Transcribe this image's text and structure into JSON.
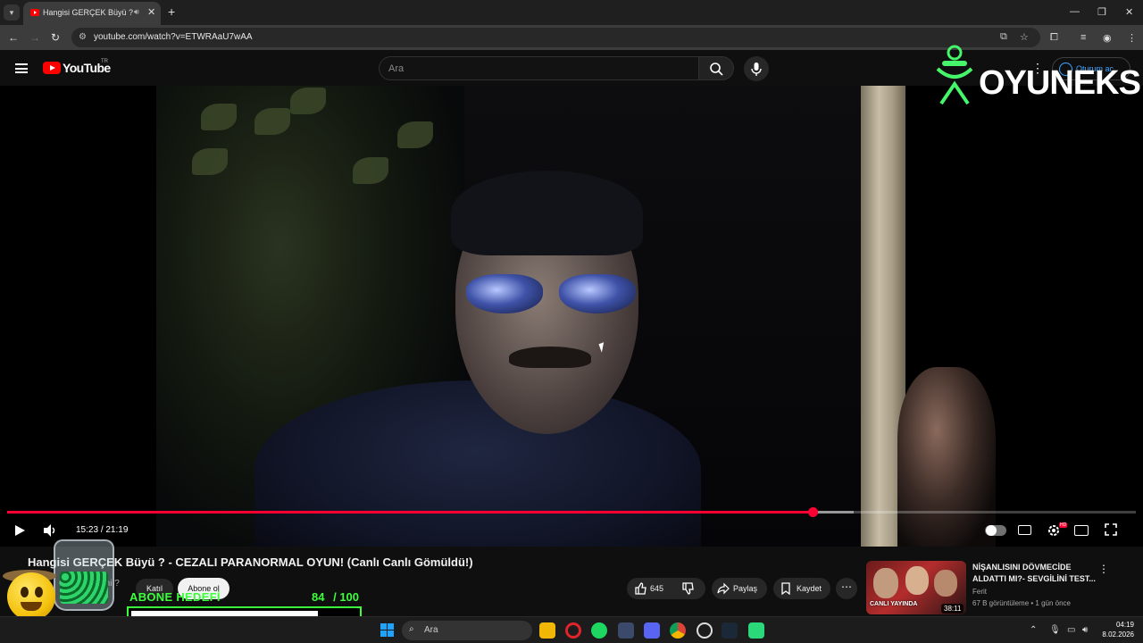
{
  "browser": {
    "tab_title": "Hangisi GERÇEK Büyü ? - C",
    "url": "youtube.com/watch?v=ETWRAaU7wAA"
  },
  "youtube": {
    "logo_text": "YouTube",
    "country": "TR",
    "search_placeholder": "Ara",
    "signin_label": "Oturum aç"
  },
  "player": {
    "time_current": "15:23",
    "time_total": "21:19",
    "played_fraction": 0.714,
    "buffered_fraction": 0.75,
    "hd_badge": "HD"
  },
  "video": {
    "title": "Hangisi GERÇEK Büyü ? - CEZALI PARANORMAL OYUN! (Canlı Canlı Gömüldü!)",
    "channel_sub": "Gerçekten mi ?",
    "join_label": "Katıl",
    "subscribe_label": "Abone ol",
    "like_count": "645",
    "share_label": "Paylaş",
    "save_label": "Kaydet"
  },
  "recommendation": {
    "title": "NİŞANLISINI DÖVMECİDE ALDATTI MI?- SEVGİLİNİ TEST...",
    "channel": "Ferit",
    "meta": "67 B görüntüleme • 1 gün önce",
    "duration": "38:11",
    "thumb_text": "CANLI YAYINDA"
  },
  "overlay": {
    "brand_text": "OYUNEKS",
    "goal_label": "ABONE HEDEFİ",
    "goal_current": "84",
    "goal_total": "/ 100",
    "goal_fraction": 0.84
  },
  "taskbar": {
    "search_placeholder": "Ara",
    "time": "04:19",
    "date": "8.02.2026"
  },
  "colors": {
    "accent_red": "#ff0033",
    "goal_green": "#3cff3c",
    "link_blue": "#3ea6ff"
  }
}
